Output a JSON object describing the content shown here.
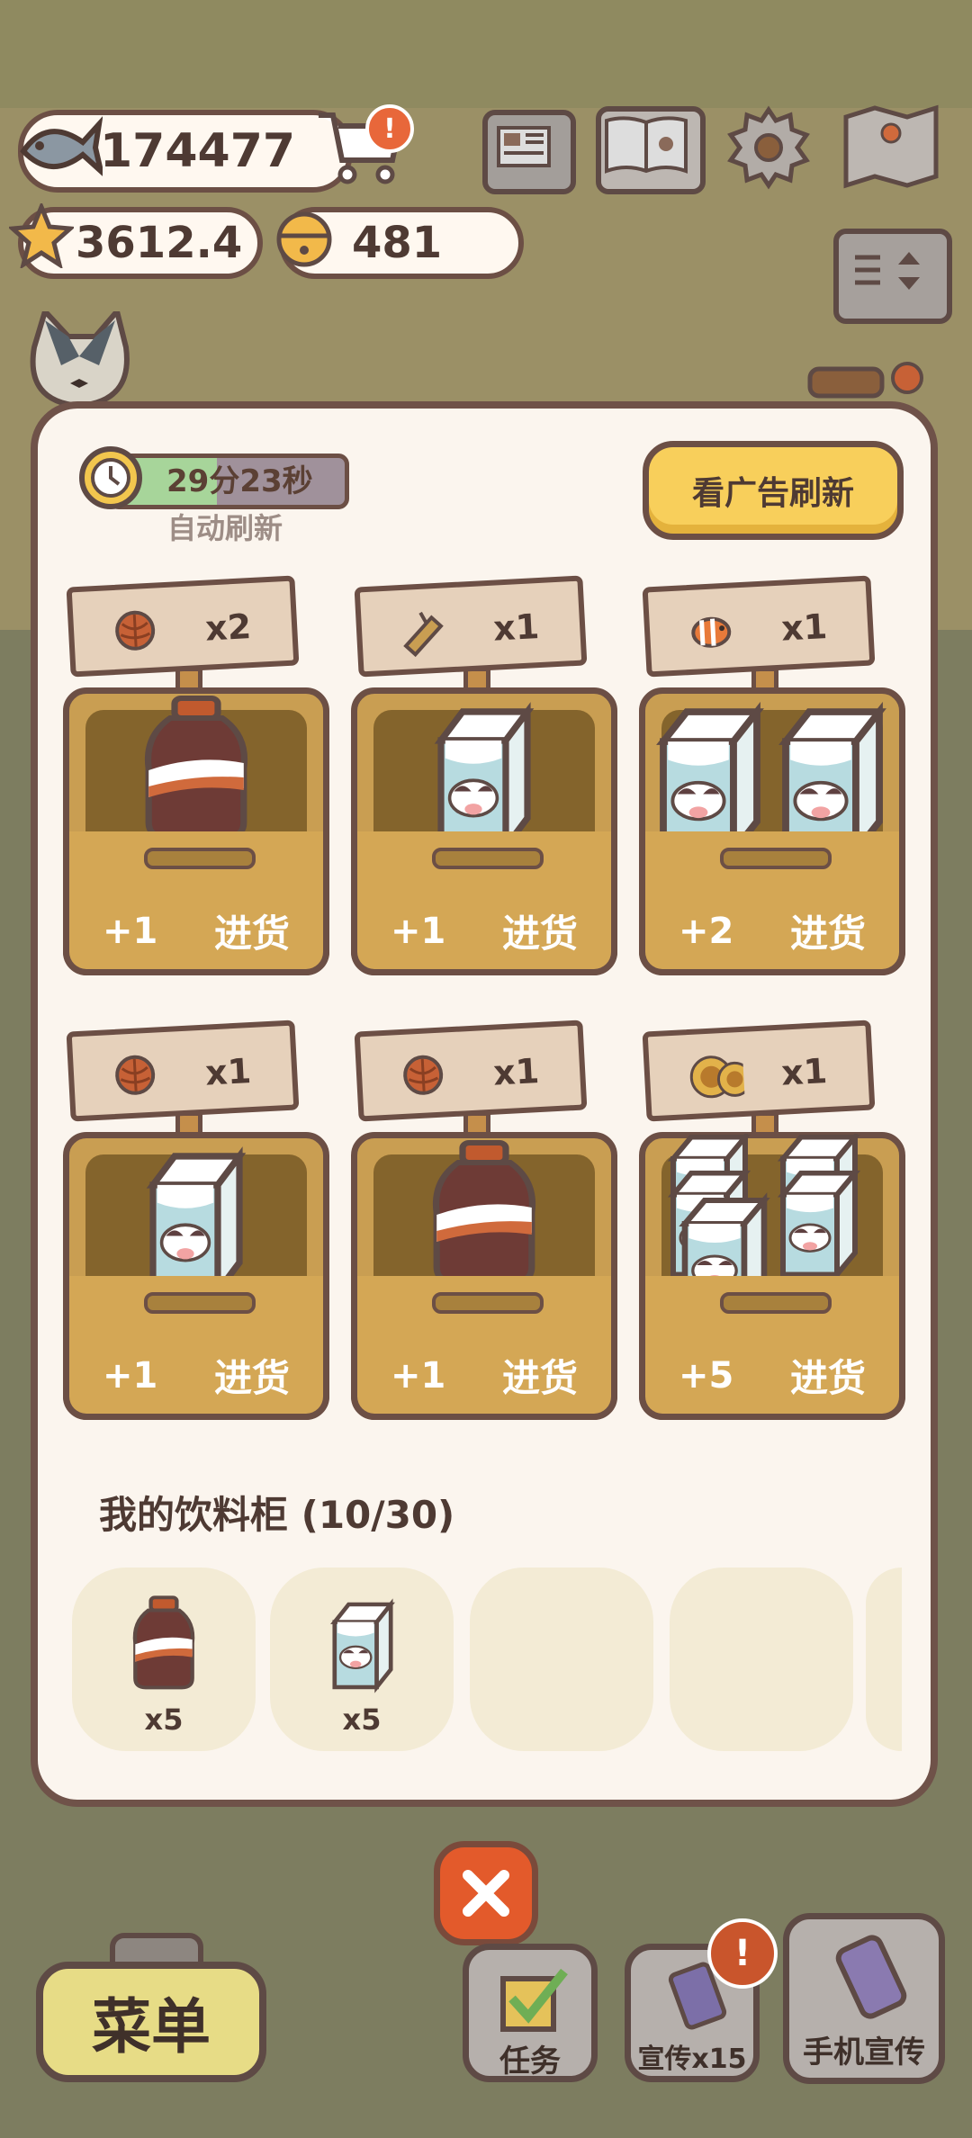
{
  "currencies": {
    "fish": "174477",
    "stars": "3612.4",
    "bells": "481"
  },
  "refresh": {
    "timer": "29分23秒",
    "label": "自动刷新",
    "ad_button": "看广告刷新",
    "progress": 0.45
  },
  "shop": [
    {
      "sign_qty": "x2",
      "sign_icon": "yarn-ball-icon",
      "goods": "cola-bottle",
      "count": 1,
      "plus": "+1",
      "action": "进货"
    },
    {
      "sign_qty": "x1",
      "sign_icon": "wood-log-icon",
      "goods": "milk-carton",
      "count": 1,
      "plus": "+1",
      "action": "进货"
    },
    {
      "sign_qty": "x1",
      "sign_icon": "clownfish-icon",
      "goods": "milk-carton",
      "count": 2,
      "plus": "+2",
      "action": "进货"
    },
    {
      "sign_qty": "x1",
      "sign_icon": "yarn-ball-icon",
      "goods": "milk-carton",
      "count": 1,
      "plus": "+1",
      "action": "进货"
    },
    {
      "sign_qty": "x1",
      "sign_icon": "yarn-ball-icon",
      "goods": "cola-bottle",
      "count": 1,
      "plus": "+1",
      "action": "进货"
    },
    {
      "sign_qty": "x1",
      "sign_icon": "sunflower-icon",
      "goods": "milk-carton",
      "count": 5,
      "plus": "+5",
      "action": "进货"
    }
  ],
  "cabinet": {
    "title": "我的饮料柜 (10/30)",
    "items": [
      {
        "goods": "cola-bottle",
        "count": "x5"
      },
      {
        "goods": "milk-carton",
        "count": "x5"
      },
      {
        "goods": "",
        "count": ""
      },
      {
        "goods": "",
        "count": ""
      }
    ]
  },
  "bottom": {
    "menu": "菜单",
    "tasks": "任务",
    "promo": "宣传x15",
    "phone_promo": "手机宣传"
  },
  "colors": {
    "accent": "#f8cf5b",
    "close": "#e35a2b",
    "border": "#6c4f45",
    "panel": "#fbf5ee"
  }
}
